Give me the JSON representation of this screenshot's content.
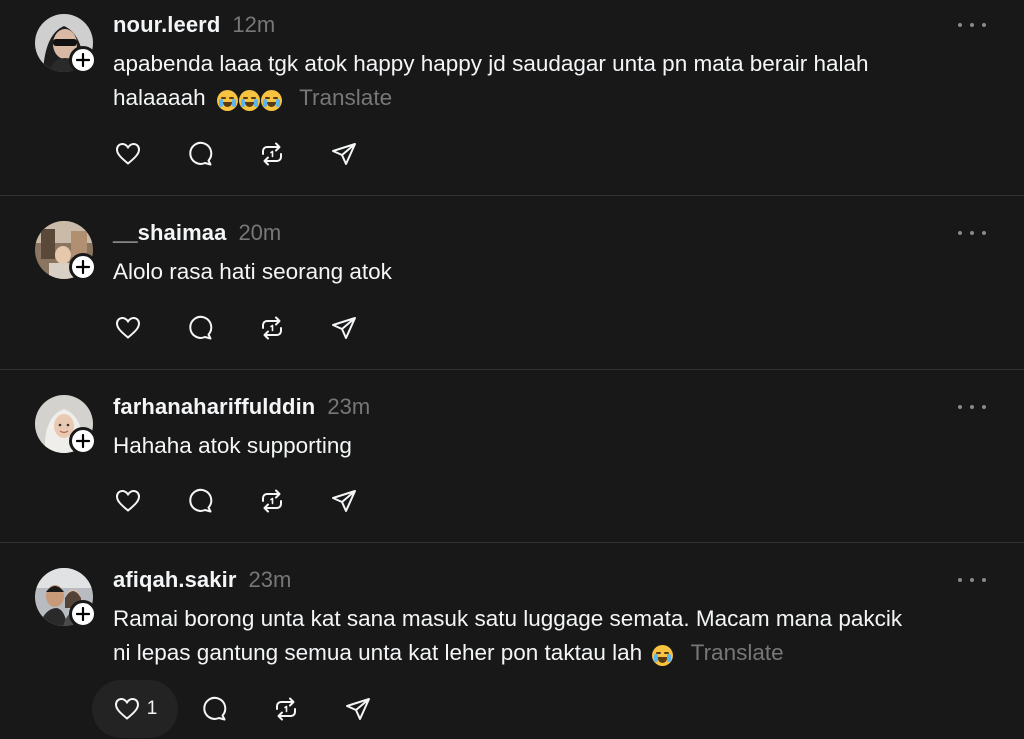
{
  "icons": {
    "like": "heart-icon",
    "reply": "comment-bubble-icon",
    "repost": "repost-icon",
    "share": "send-icon",
    "more": "more-dots-icon",
    "follow": "plus-icon"
  },
  "colors": {
    "background": "#181818",
    "text": "#f3f5f7",
    "muted": "#777777",
    "divider": "#323232"
  },
  "posts": [
    {
      "username": "nour.leerd",
      "time": "12m",
      "text_line1": "apabenda laaa tgk atok happy happy jd saudagar unta pn mata berair halah",
      "text_line2": "halaaaah",
      "emoji": "😭😭😭",
      "translate": "Translate"
    },
    {
      "username": "__shaimaa",
      "time": "20m",
      "text_line1": "Alolo rasa hati seorang atok"
    },
    {
      "username": "farhanahariffulddin",
      "time": "23m",
      "text_line1": "Hahaha atok supporting"
    },
    {
      "username": "afiqah.sakir",
      "time": "23m",
      "text_line1": "Ramai borong unta kat sana masuk satu luggage semata. Macam mana pakcik",
      "text_line2": "ni lepas gantung semua unta kat leher pon taktau lah",
      "emoji": "😂",
      "translate": "Translate",
      "like_count": "1"
    }
  ]
}
